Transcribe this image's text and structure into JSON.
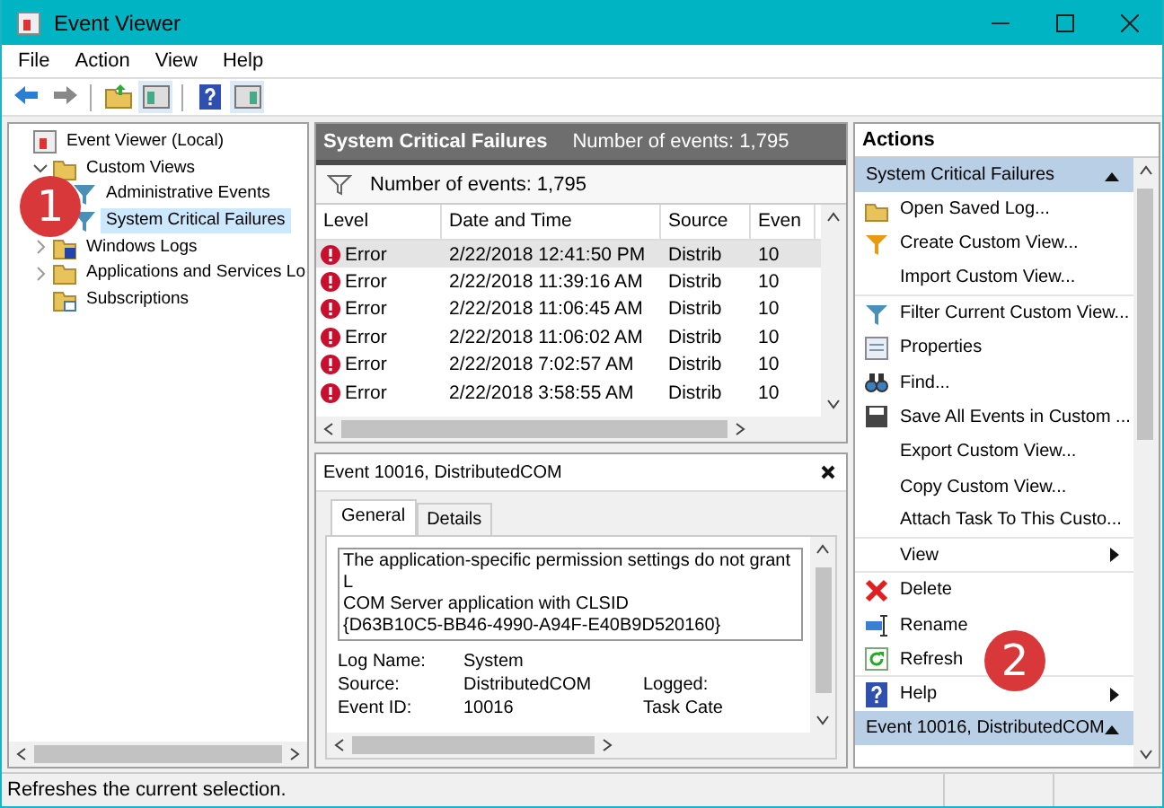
{
  "window": {
    "title": "Event Viewer"
  },
  "menu": [
    "File",
    "Action",
    "View",
    "Help"
  ],
  "tree": [
    {
      "label": "Event Viewer (Local)",
      "kind": "root",
      "children": [
        {
          "label": "Custom Views",
          "kind": "folder",
          "expanded": true,
          "children": [
            {
              "label": "Administrative Events",
              "kind": "filter",
              "selected": false
            },
            {
              "label": "System Critical Failures",
              "kind": "filter",
              "selected": true
            }
          ]
        },
        {
          "label": "Windows Logs",
          "kind": "logs",
          "expanded": false
        },
        {
          "label": "Applications and Services Lo",
          "kind": "folder",
          "expanded": false
        },
        {
          "label": "Subscriptions",
          "kind": "subscriptions"
        }
      ]
    }
  ],
  "events_pane": {
    "title": "System Critical Failures",
    "count": "Number of events: 1,795",
    "filter_text": "Number of events: 1,795",
    "columns": [
      "Level",
      "Date and Time",
      "Source",
      "Even"
    ],
    "rows": [
      {
        "level": "Error",
        "date": "2/22/2018 12:41:50 PM",
        "source": "Distrib",
        "event": "10",
        "selected": true
      },
      {
        "level": "Error",
        "date": "2/22/2018 11:39:16 AM",
        "source": "Distrib",
        "event": "10",
        "selected": false
      },
      {
        "level": "Error",
        "date": "2/22/2018 11:06:45 AM",
        "source": "Distrib",
        "event": "10",
        "selected": false
      },
      {
        "level": "Error",
        "date": "2/22/2018 11:06:02 AM",
        "source": "Distrib",
        "event": "10",
        "selected": false
      },
      {
        "level": "Error",
        "date": "2/22/2018 7:02:57 AM",
        "source": "Distrib",
        "event": "10",
        "selected": false
      },
      {
        "level": "Error",
        "date": "2/22/2018 3:58:55 AM",
        "source": "Distrib",
        "event": "10",
        "selected": false
      }
    ]
  },
  "detail_pane": {
    "title": "Event 10016, DistributedCOM",
    "tabs": [
      {
        "label": "General",
        "selected": true
      },
      {
        "label": "Details",
        "selected": false
      }
    ],
    "description": [
      "The application-specific permission settings do not grant L",
      "COM Server application with CLSID",
      "{D63B10C5-BB46-4990-A94F-E40B9D520160}"
    ],
    "fields": [
      {
        "label": "Log Name:",
        "value": "System"
      },
      {
        "label": "Source:",
        "value": "DistributedCOM",
        "label_2": "Logged:"
      },
      {
        "label": "Event ID:",
        "value": "10016",
        "label_2": "Task Cate"
      }
    ]
  },
  "actions": {
    "title": "Actions",
    "sections": [
      {
        "title": "System Critical Failures",
        "items": [
          {
            "label": "Open Saved Log...",
            "kind": "open"
          },
          {
            "label": "Create Custom View...",
            "kind": "create"
          },
          {
            "label": "Import Custom View...",
            "kind": "plain",
            "separator_after": true
          },
          {
            "label": "Filter Current Custom View...",
            "kind": "filter"
          },
          {
            "label": "Properties",
            "kind": "properties"
          },
          {
            "label": "Find...",
            "kind": "find"
          },
          {
            "label": "Save All Events in Custom ...",
            "kind": "save"
          },
          {
            "label": "Export Custom View...",
            "kind": "plain"
          },
          {
            "label": "Copy Custom View...",
            "kind": "plain"
          },
          {
            "label": "Attach Task To This Custo...",
            "kind": "plain",
            "separator_after": true
          },
          {
            "label": "View",
            "kind": "plain",
            "submenu": true,
            "separator_after": true
          },
          {
            "label": "Delete",
            "kind": "delete"
          },
          {
            "label": "Rename",
            "kind": "rename"
          },
          {
            "label": "Refresh",
            "kind": "refresh",
            "separator_after": true
          },
          {
            "label": "Help",
            "kind": "help",
            "submenu": true
          }
        ]
      },
      {
        "title": "Event 10016, DistributedCOM"
      }
    ]
  },
  "status_bar": "Refreshes the current selection.",
  "annotations": [
    {
      "number": "1"
    },
    {
      "number": "2"
    }
  ]
}
